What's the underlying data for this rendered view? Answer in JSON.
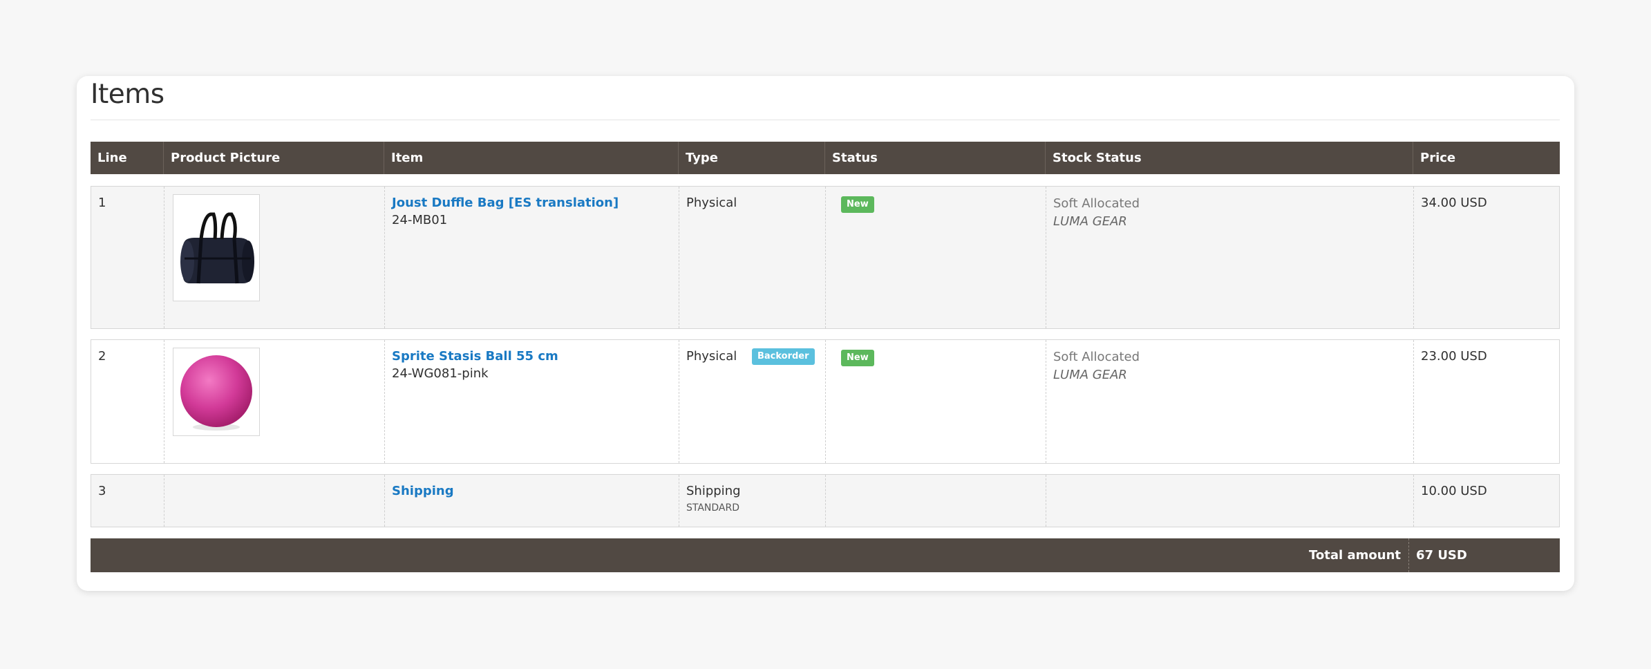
{
  "section": {
    "title": "Items"
  },
  "table": {
    "columns": [
      "Line",
      "Product Picture",
      "Item",
      "Type",
      "Status",
      "Stock Status",
      "Price"
    ],
    "rows": [
      {
        "line": "1",
        "picture": "duffle-bag-image",
        "item_name": "Joust Duffle Bag [ES translation]",
        "sku": "24-MB01",
        "type": "Physical",
        "type_badge": "",
        "status": "New",
        "stock_status": "Soft Allocated",
        "stock_source": "LUMA GEAR",
        "price": "34.00 USD"
      },
      {
        "line": "2",
        "picture": "stasis-ball-image",
        "item_name": "Sprite Stasis Ball 55 cm",
        "sku": "24-WG081-pink",
        "type": "Physical",
        "type_badge": "Backorder",
        "status": "New",
        "stock_status": "Soft Allocated",
        "stock_source": "LUMA GEAR",
        "price": "23.00 USD"
      },
      {
        "line": "3",
        "item_name": "Shipping",
        "type": "Shipping",
        "type_sub": "STANDARD",
        "price": "10.00 USD"
      }
    ],
    "footer": {
      "label": "Total amount",
      "value": "67 USD"
    }
  },
  "colors": {
    "header_bg": "#514943",
    "link": "#1979c3",
    "badge_new": "#5cb85c",
    "badge_backorder": "#5bc0de"
  }
}
